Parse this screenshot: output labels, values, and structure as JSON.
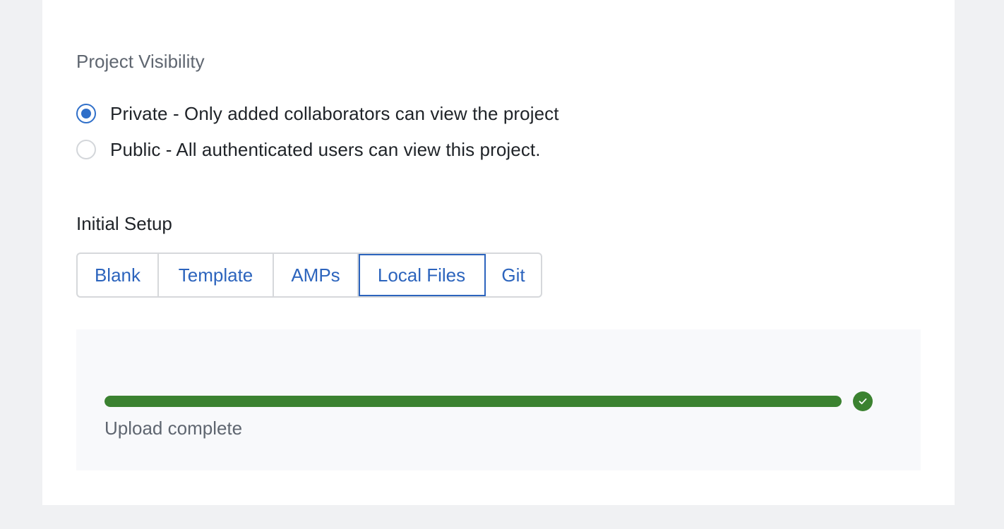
{
  "visibility": {
    "label": "Project Visibility",
    "options": [
      {
        "label": "Private - Only added collaborators can view the project",
        "checked": true
      },
      {
        "label": "Public - All authenticated users can view this project.",
        "checked": false
      }
    ]
  },
  "setup": {
    "label": "Initial Setup",
    "tabs": [
      {
        "label": "Blank",
        "active": false
      },
      {
        "label": "Template",
        "active": false
      },
      {
        "label": "AMPs",
        "active": false
      },
      {
        "label": "Local Files",
        "active": true
      },
      {
        "label": "Git",
        "active": false
      }
    ]
  },
  "upload": {
    "progress_percent": 100,
    "status": "Upload complete",
    "status_icon": "check-circle-icon"
  },
  "colors": {
    "accent": "#2c64bd",
    "success": "#3b8230",
    "page_background": "#f0f1f3",
    "panel_background": "#f8f9fb"
  }
}
